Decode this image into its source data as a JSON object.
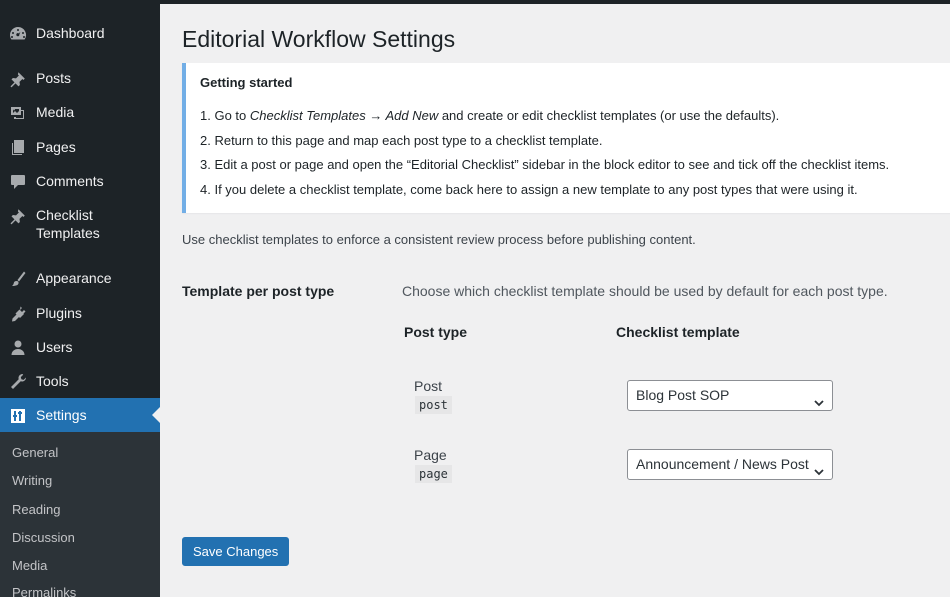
{
  "sidebar": {
    "items": [
      {
        "label": "Dashboard",
        "icon": "dashboard-icon"
      },
      {
        "label": "Posts",
        "icon": "pin-icon"
      },
      {
        "label": "Media",
        "icon": "media-icon"
      },
      {
        "label": "Pages",
        "icon": "pages-icon"
      },
      {
        "label": "Comments",
        "icon": "comments-icon"
      },
      {
        "label": "Checklist Templates",
        "label_line1": "Checklist",
        "label_line2": "Templates",
        "icon": "pin-icon"
      },
      {
        "label": "Appearance",
        "icon": "brush-icon"
      },
      {
        "label": "Plugins",
        "icon": "plugin-icon"
      },
      {
        "label": "Users",
        "icon": "user-icon"
      },
      {
        "label": "Tools",
        "icon": "wrench-icon"
      },
      {
        "label": "Settings",
        "icon": "settings-icon",
        "current": true
      }
    ],
    "submenu": [
      "General",
      "Writing",
      "Reading",
      "Discussion",
      "Media",
      "Permalinks"
    ]
  },
  "page": {
    "title": "Editorial Workflow Settings",
    "notice": {
      "title": "Getting started",
      "steps": [
        {
          "prefix": "1. Go to ",
          "em": "Checklist Templates → Add New",
          "suffix": " and create or edit checklist templates (or use the defaults)."
        },
        {
          "text": "2. Return to this page and map each post type to a checklist template."
        },
        {
          "text": "3. Edit a post or page and open the “Editorial Checklist” sidebar in the block editor to see and tick off the checklist items."
        },
        {
          "text": "4. If you delete a checklist template, come back here to assign a new template to any post types that were using it."
        }
      ]
    },
    "intro": "Use checklist templates to enforce a consistent review process before publishing content.",
    "field": {
      "label": "Template per post type",
      "description": "Choose which checklist template should be used by default for each post type.",
      "col_post_type": "Post type",
      "col_template": "Checklist template",
      "rows": [
        {
          "name": "Post",
          "slug": "post",
          "template": "Blog Post SOP"
        },
        {
          "name": "Page",
          "slug": "page",
          "template": "Announcement / News Post"
        }
      ]
    },
    "save_label": "Save Changes"
  },
  "colors": {
    "sidebar_bg": "#1d2327",
    "accent": "#2271b1",
    "notice_border": "#72aee6",
    "page_bg": "#f0f0f1"
  }
}
